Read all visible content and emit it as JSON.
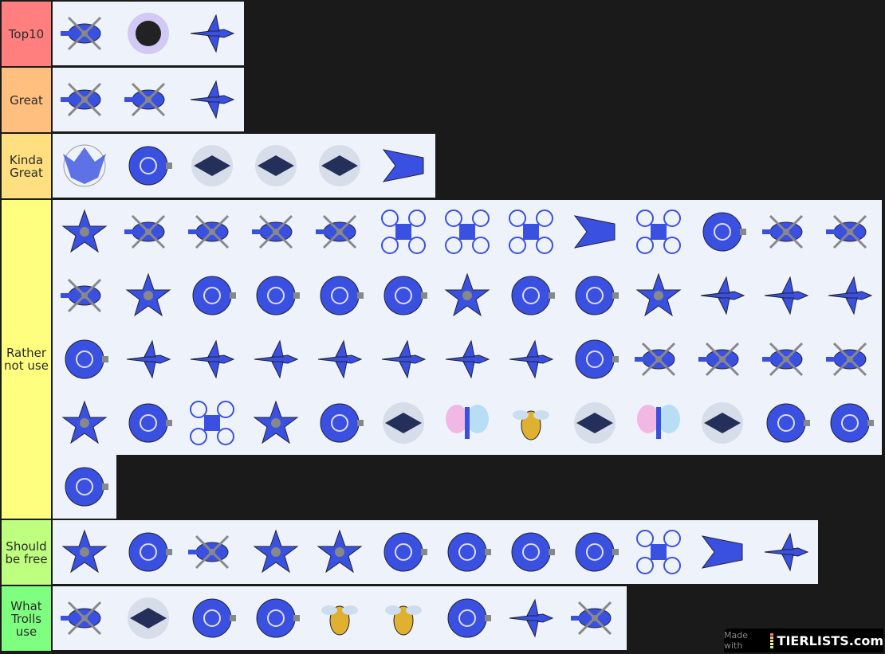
{
  "colors": {
    "background": "#1a1a1a",
    "tile": "#eef3fb",
    "ship_blue": "#3a50e0",
    "rotor_gray": "#888888"
  },
  "tiers": [
    {
      "label": "Top10",
      "color": "#ff7f7f",
      "items": [
        "helicopter",
        "dark-spiked-ship",
        "jet"
      ]
    },
    {
      "label": "Great",
      "color": "#ffbf7f",
      "items": [
        "helicopter",
        "helicopter",
        "jet"
      ]
    },
    {
      "label": "Kinda Great",
      "color": "#ffdf7f",
      "items": [
        "bat-ship",
        "round-ship",
        "dark-ship",
        "dark-ship",
        "dark-ship",
        "wing-ship"
      ]
    },
    {
      "label": "Rather not use",
      "color": "#ffff7f",
      "items": [
        "star-ship",
        "helicopter",
        "helicopter",
        "helicopter",
        "helicopter",
        "drone",
        "drone",
        "drone",
        "wing-ship",
        "drone",
        "round-ship",
        "helicopter",
        "helicopter",
        "helicopter",
        "star-ship",
        "round-ship",
        "round-ship",
        "round-ship",
        "round-ship",
        "star-ship",
        "round-ship",
        "round-ship",
        "star-ship",
        "jet",
        "jet",
        "jet",
        "round-ship",
        "jet",
        "jet",
        "jet",
        "jet",
        "jet",
        "jet",
        "jet",
        "round-ship",
        "helicopter",
        "helicopter",
        "helicopter",
        "helicopter",
        "star-ship",
        "round-ship",
        "drone",
        "star-ship",
        "round-ship",
        "dark-ship",
        "butterfly",
        "bee",
        "dark-ship",
        "butterfly",
        "dark-ship",
        "round-ship",
        "round-ship",
        "round-ship"
      ]
    },
    {
      "label": "Should be free",
      "color": "#bfff7f",
      "items": [
        "star-ship",
        "round-ship",
        "helicopter",
        "star-ship",
        "star-ship",
        "round-ship",
        "round-ship",
        "round-ship",
        "round-ship",
        "drone",
        "wing-ship",
        "jet"
      ]
    },
    {
      "label": "What Trolls use",
      "color": "#7fff7f",
      "items": [
        "helicopter",
        "dark-ship",
        "round-ship",
        "round-ship",
        "bee",
        "bee",
        "round-ship",
        "jet",
        "helicopter"
      ]
    }
  ],
  "watermark": {
    "prefix": "Made with",
    "brand": "TIERLISTS.com"
  }
}
